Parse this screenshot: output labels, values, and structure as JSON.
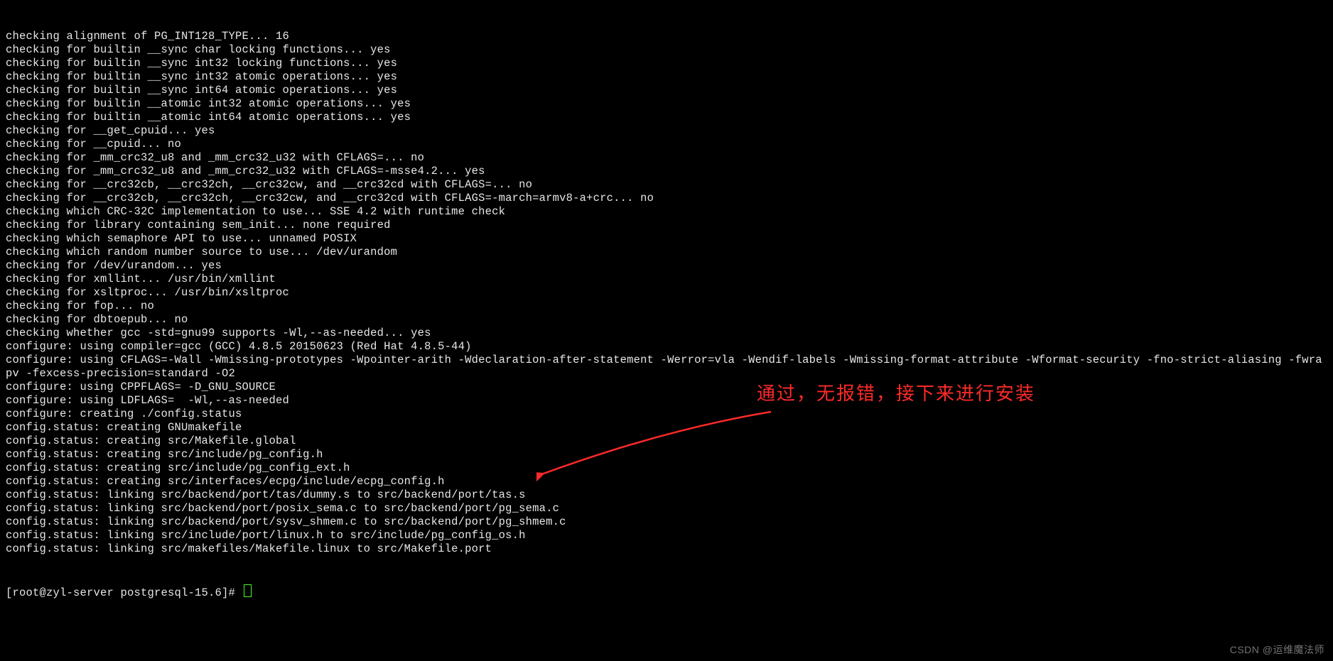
{
  "terminal": {
    "lines": [
      "checking alignment of PG_INT128_TYPE... 16",
      "checking for builtin __sync char locking functions... yes",
      "checking for builtin __sync int32 locking functions... yes",
      "checking for builtin __sync int32 atomic operations... yes",
      "checking for builtin __sync int64 atomic operations... yes",
      "checking for builtin __atomic int32 atomic operations... yes",
      "checking for builtin __atomic int64 atomic operations... yes",
      "checking for __get_cpuid... yes",
      "checking for __cpuid... no",
      "checking for _mm_crc32_u8 and _mm_crc32_u32 with CFLAGS=... no",
      "checking for _mm_crc32_u8 and _mm_crc32_u32 with CFLAGS=-msse4.2... yes",
      "checking for __crc32cb, __crc32ch, __crc32cw, and __crc32cd with CFLAGS=... no",
      "checking for __crc32cb, __crc32ch, __crc32cw, and __crc32cd with CFLAGS=-march=armv8-a+crc... no",
      "checking which CRC-32C implementation to use... SSE 4.2 with runtime check",
      "checking for library containing sem_init... none required",
      "checking which semaphore API to use... unnamed POSIX",
      "checking which random number source to use... /dev/urandom",
      "checking for /dev/urandom... yes",
      "checking for xmllint... /usr/bin/xmllint",
      "checking for xsltproc... /usr/bin/xsltproc",
      "checking for fop... no",
      "checking for dbtoepub... no",
      "checking whether gcc -std=gnu99 supports -Wl,--as-needed... yes",
      "configure: using compiler=gcc (GCC) 4.8.5 20150623 (Red Hat 4.8.5-44)",
      "configure: using CFLAGS=-Wall -Wmissing-prototypes -Wpointer-arith -Wdeclaration-after-statement -Werror=vla -Wendif-labels -Wmissing-format-attribute -Wformat-security -fno-strict-aliasing -fwrapv -fexcess-precision=standard -O2",
      "configure: using CPPFLAGS= -D_GNU_SOURCE",
      "configure: using LDFLAGS=  -Wl,--as-needed",
      "configure: creating ./config.status",
      "config.status: creating GNUmakefile",
      "config.status: creating src/Makefile.global",
      "config.status: creating src/include/pg_config.h",
      "config.status: creating src/include/pg_config_ext.h",
      "config.status: creating src/interfaces/ecpg/include/ecpg_config.h",
      "config.status: linking src/backend/port/tas/dummy.s to src/backend/port/tas.s",
      "config.status: linking src/backend/port/posix_sema.c to src/backend/port/pg_sema.c",
      "config.status: linking src/backend/port/sysv_shmem.c to src/backend/port/pg_shmem.c",
      "config.status: linking src/include/port/linux.h to src/include/pg_config_os.h",
      "config.status: linking src/makefiles/Makefile.linux to src/Makefile.port"
    ],
    "prompt": "[root@zyl-server postgresql-15.6]# "
  },
  "annotation": {
    "text": "通过，无报错，接下来进行安装",
    "color": "#ff2a2a"
  },
  "watermark": {
    "text": "CSDN @运维魔法师"
  }
}
